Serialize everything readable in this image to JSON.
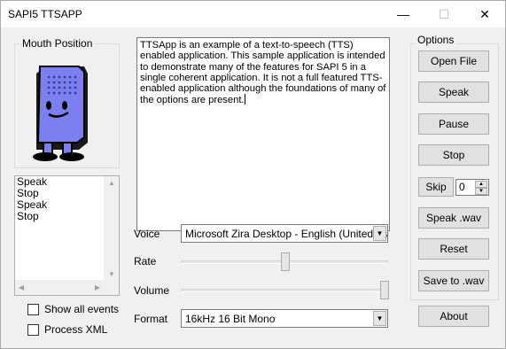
{
  "window": {
    "title": "SAPI5 TTSAPP",
    "minimize_glyph": "—",
    "maximize_glyph": "☐",
    "close_glyph": "✕"
  },
  "mouth": {
    "group_label": "Mouth Position",
    "character_colors": {
      "body": "#7b7ff0",
      "shadow": "#1a1a1a",
      "mouth": "#000000"
    }
  },
  "events": {
    "items": [
      "Speak",
      "Stop",
      "Speak",
      "Stop"
    ]
  },
  "checkboxes": {
    "show_all_events": "Show all events",
    "process_xml": "Process XML"
  },
  "main_text": "TTSApp is an example of a text-to-speech (TTS) enabled application. This sample application is intended to demonstrate many of the features for SAPI 5 in a single coherent application. It is not a full featured TTS-enabled application although the foundations of many of the options are present.",
  "controls": {
    "voice_label": "Voice",
    "voice_value": "Microsoft Zira Desktop - English (United States)",
    "rate_label": "Rate",
    "volume_label": "Volume",
    "format_label": "Format",
    "format_value": "16kHz 16 Bit Mono"
  },
  "options": {
    "group_label": "Options",
    "open_file": "Open File",
    "speak": "Speak",
    "pause": "Pause",
    "stop": "Stop",
    "skip": "Skip",
    "skip_value": "0",
    "speak_wav": "Speak .wav",
    "reset": "Reset",
    "save_to_wav": "Save to .wav",
    "about": "About"
  }
}
